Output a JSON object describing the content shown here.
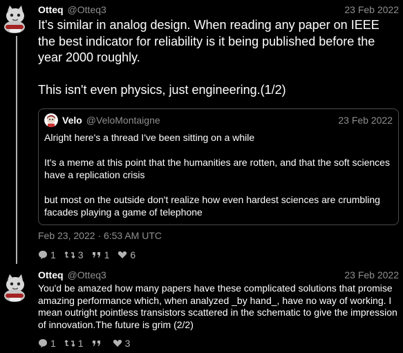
{
  "tweets": [
    {
      "author": "Otteq",
      "handle": "@Otteq3",
      "date": "23 Feb 2022",
      "paragraphs": [
        "It's similar in analog design. When reading any paper on IEEE the best indicator for reliability is it being published before the year 2000 roughly.",
        "This isn't even physics, just engineering.(1/2)"
      ],
      "quote": {
        "author": "Velo",
        "handle": "@VeloMontaigne",
        "date": "23 Feb 2022",
        "paragraphs": [
          "Alright here's a thread I've been sitting on a while",
          "It's a meme at this point that the humanities are rotten, and that the soft sciences have a replication crisis",
          "but most on the outside don't realize how even hardest sciences are crumbling facades playing a game of telephone"
        ]
      },
      "timestamp": "Feb 23, 2022 · 6:53 AM UTC",
      "stats": {
        "replies": "1",
        "retweets": "3",
        "quotes": "1",
        "likes": "6"
      }
    },
    {
      "author": "Otteq",
      "handle": "@Otteq3",
      "date": "23 Feb 2022",
      "text": "You'd be amazed how many papers have these complicated solutions that promise amazing performance which, when analyzed _by hand_, have no way of working. I mean outright pointless transistors scattered in the schematic to give the impression of innovation.The future is grim (2/2)",
      "stats": {
        "replies": "1",
        "retweets": "1",
        "quotes": "",
        "likes": "3"
      }
    }
  ],
  "icons": {
    "reply": "comment-icon",
    "retweet": "retweet-icon",
    "quote": "quote-icon",
    "like": "heart-icon"
  },
  "colors": {
    "background": "#000000",
    "muted": "#8f8f8f",
    "border": "#4a4a4a",
    "thread_line": "#b2b2b2"
  }
}
